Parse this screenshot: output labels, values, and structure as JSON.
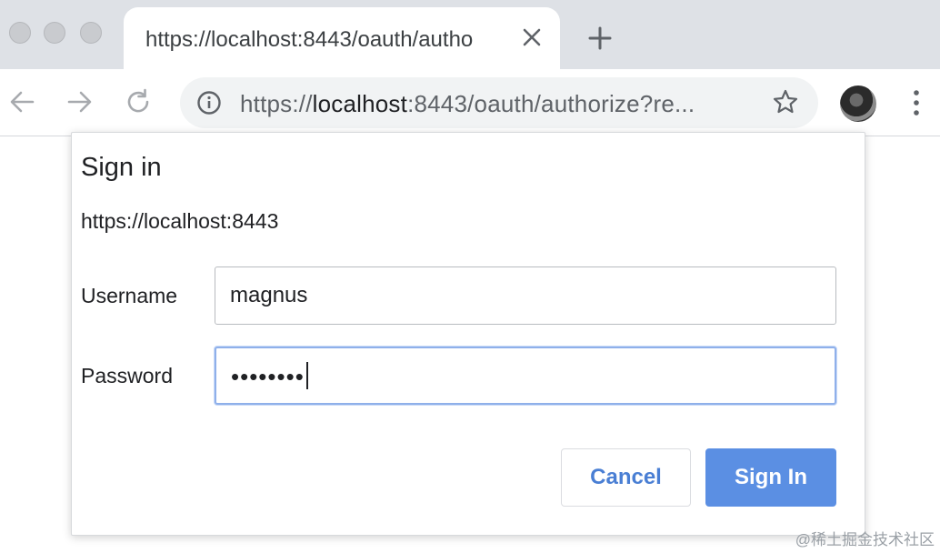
{
  "tab": {
    "title": "https://localhost:8443/oauth/autho",
    "close_icon": "close-icon",
    "new_tab_icon": "plus-icon"
  },
  "toolbar": {
    "back_icon": "arrow-left-icon",
    "forward_icon": "arrow-right-icon",
    "reload_icon": "reload-icon",
    "info_icon": "info-icon",
    "star_icon": "star-icon",
    "menu_icon": "kebab-menu-icon"
  },
  "address_bar": {
    "scheme": "https://",
    "host": "localhost",
    "rest": ":8443/oauth/authorize?re..."
  },
  "dialog": {
    "title": "Sign in",
    "origin": "https://localhost:8443",
    "username_label": "Username",
    "username_value": "magnus",
    "password_label": "Password",
    "password_mask": "••••••••",
    "cancel_label": "Cancel",
    "signin_label": "Sign In"
  },
  "watermark": "@稀土掘金技术社区",
  "colors": {
    "primary_button": "#5b8fe3",
    "cancel_text": "#4a7fd4",
    "focus_ring": "#8fb0ea",
    "tabstrip": "#dee1e6",
    "omnibox": "#f1f3f4"
  }
}
